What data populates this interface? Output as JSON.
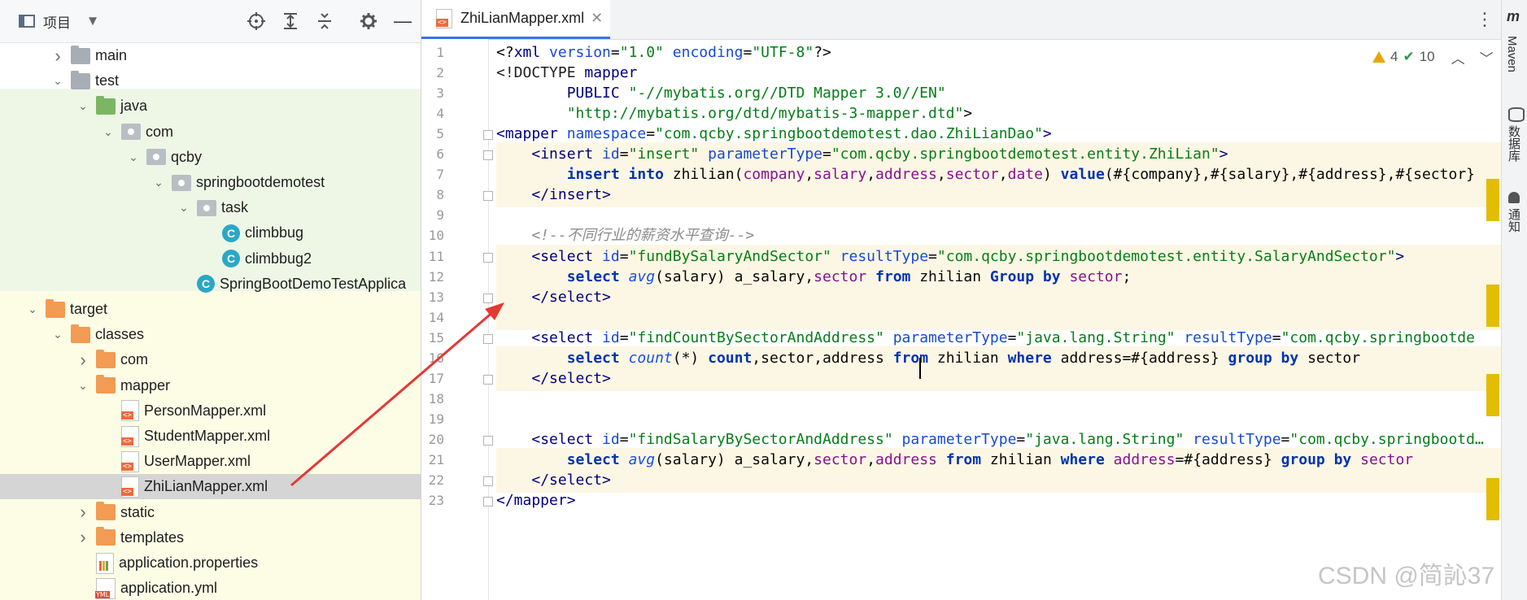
{
  "project_panel": {
    "title": "项目",
    "tree": [
      {
        "label": "main",
        "icon": "folder-grey-icon",
        "indent": 1,
        "chevron": "right"
      },
      {
        "label": "test",
        "icon": "folder-grey-icon",
        "indent": 1,
        "chevron": "down"
      },
      {
        "label": "java",
        "icon": "folder-green-icon",
        "indent": 2,
        "chevron": "down"
      },
      {
        "label": "com",
        "icon": "package-icon",
        "indent": 3,
        "chevron": "down"
      },
      {
        "label": "qcby",
        "icon": "package-icon",
        "indent": 4,
        "chevron": "down"
      },
      {
        "label": "springbootdemotest",
        "icon": "package-icon",
        "indent": 5,
        "chevron": "down"
      },
      {
        "label": "task",
        "icon": "package-icon",
        "indent": 6,
        "chevron": "down"
      },
      {
        "label": "climbbug",
        "icon": "class-icon",
        "indent": 7,
        "chevron": "none"
      },
      {
        "label": "climbbug2",
        "icon": "class-icon",
        "indent": 7,
        "chevron": "none"
      },
      {
        "label": "SpringBootDemoTestApplica",
        "icon": "class-icon",
        "indent": 6,
        "chevron": "none"
      },
      {
        "label": "target",
        "icon": "folder-orange-icon",
        "indent": 0,
        "chevron": "down"
      },
      {
        "label": "classes",
        "icon": "folder-orange-icon",
        "indent": 1,
        "chevron": "down"
      },
      {
        "label": "com",
        "icon": "folder-orange-icon",
        "indent": 2,
        "chevron": "right"
      },
      {
        "label": "mapper",
        "icon": "folder-orange-icon",
        "indent": 2,
        "chevron": "down"
      },
      {
        "label": "PersonMapper.xml",
        "icon": "xml-file-icon",
        "indent": 3,
        "chevron": "none"
      },
      {
        "label": "StudentMapper.xml",
        "icon": "xml-file-icon",
        "indent": 3,
        "chevron": "none"
      },
      {
        "label": "UserMapper.xml",
        "icon": "xml-file-icon",
        "indent": 3,
        "chevron": "none"
      },
      {
        "label": "ZhiLianMapper.xml",
        "icon": "xml-file-icon",
        "indent": 3,
        "chevron": "none",
        "selected": true
      },
      {
        "label": "static",
        "icon": "folder-orange-icon",
        "indent": 2,
        "chevron": "right"
      },
      {
        "label": "templates",
        "icon": "folder-orange-icon",
        "indent": 2,
        "chevron": "right"
      },
      {
        "label": "application.properties",
        "icon": "properties-file-icon",
        "indent": 2,
        "chevron": "none"
      },
      {
        "label": "application.yml",
        "icon": "yml-file-icon",
        "indent": 2,
        "chevron": "none"
      }
    ]
  },
  "editor": {
    "tab_label": "ZhiLianMapper.xml",
    "inspections": {
      "warnings": "4",
      "ok": "10"
    },
    "lines": [
      {
        "n": "1",
        "hl": false,
        "tokens": [
          [
            "plain",
            "<?"
          ],
          [
            "tag",
            "xml"
          ],
          [
            "attr",
            " version"
          ],
          [
            "plain",
            "="
          ],
          [
            "val",
            "\"1.0\""
          ],
          [
            "attr",
            " encoding"
          ],
          [
            "plain",
            "="
          ],
          [
            "val",
            "\"UTF-8\""
          ],
          [
            "plain",
            "?>"
          ]
        ]
      },
      {
        "n": "2",
        "hl": false,
        "tokens": [
          [
            "tagbg",
            "<!DOCTYPE "
          ],
          [
            "tag",
            "mapper"
          ]
        ]
      },
      {
        "n": "3",
        "hl": false,
        "tokens": [
          [
            "tag",
            "        PUBLIC "
          ],
          [
            "val",
            "\"-//mybatis.org//DTD Mapper 3.0//EN\""
          ]
        ]
      },
      {
        "n": "4",
        "hl": false,
        "tokens": [
          [
            "val",
            "        \"http://mybatis.org/dtd/mybatis-3-mapper.dtd\""
          ],
          [
            "plain",
            ">"
          ]
        ]
      },
      {
        "n": "5",
        "hl": false,
        "tokens": [
          [
            "tag",
            "<mapper"
          ],
          [
            "attr",
            " namespace"
          ],
          [
            "plain",
            "="
          ],
          [
            "val",
            "\"com.qcby.springbootdemotest.dao.ZhiLianDao\""
          ],
          [
            "tag",
            ">"
          ]
        ]
      },
      {
        "n": "6",
        "hl": true,
        "tokens": [
          [
            "plain",
            "    "
          ],
          [
            "tag",
            "<insert"
          ],
          [
            "attr",
            " id"
          ],
          [
            "plain",
            "="
          ],
          [
            "val",
            "\"insert\""
          ],
          [
            "attr",
            " parameterType"
          ],
          [
            "plain",
            "="
          ],
          [
            "val",
            "\"com.qcby.springbootdemotest.entity.ZhiLian\""
          ],
          [
            "tag",
            ">"
          ]
        ]
      },
      {
        "n": "7",
        "hl": true,
        "tokens": [
          [
            "plain",
            "        "
          ],
          [
            "kw",
            "insert into "
          ],
          [
            "plain",
            "zhilian("
          ],
          [
            "col",
            "company"
          ],
          [
            "plain",
            ","
          ],
          [
            "col",
            "salary"
          ],
          [
            "plain",
            ","
          ],
          [
            "col",
            "address"
          ],
          [
            "plain",
            ","
          ],
          [
            "col",
            "sector"
          ],
          [
            "plain",
            ","
          ],
          [
            "col",
            "date"
          ],
          [
            "plain",
            ") "
          ],
          [
            "kw",
            "value"
          ],
          [
            "plain",
            "(#{company},#{salary},#{address},#{sector}"
          ]
        ]
      },
      {
        "n": "8",
        "hl": true,
        "tokens": [
          [
            "plain",
            "    "
          ],
          [
            "tag",
            "</insert>"
          ]
        ]
      },
      {
        "n": "9",
        "hl": false,
        "tokens": []
      },
      {
        "n": "10",
        "hl": false,
        "tokens": [
          [
            "cm",
            "    <!--不同行业的薪资水平查询-->"
          ]
        ]
      },
      {
        "n": "11",
        "hl": true,
        "tokens": [
          [
            "plain",
            "    "
          ],
          [
            "tag",
            "<select"
          ],
          [
            "attr",
            " id"
          ],
          [
            "plain",
            "="
          ],
          [
            "val",
            "\"fundBySalaryAndSector\""
          ],
          [
            "attr",
            " resultType"
          ],
          [
            "plain",
            "="
          ],
          [
            "val",
            "\"com.qcby.springbootdemotest.entity.SalaryAndSector\""
          ],
          [
            "tag",
            ">"
          ]
        ]
      },
      {
        "n": "12",
        "hl": true,
        "tokens": [
          [
            "plain",
            "        "
          ],
          [
            "kw",
            "select "
          ],
          [
            "fn",
            "avg"
          ],
          [
            "plain",
            "(salary) a_salary,"
          ],
          [
            "col",
            "sector "
          ],
          [
            "kw",
            "from "
          ],
          [
            "plain",
            "zhilian "
          ],
          [
            "kw",
            "Group by "
          ],
          [
            "col",
            "sector"
          ],
          [
            "plain",
            ";"
          ]
        ]
      },
      {
        "n": "13",
        "hl": true,
        "tokens": [
          [
            "plain",
            "    "
          ],
          [
            "tag",
            "</select>"
          ]
        ]
      },
      {
        "n": "14",
        "hl": true,
        "tokens": []
      },
      {
        "n": "15",
        "hl": false,
        "tokens": [
          [
            "plain",
            "    "
          ],
          [
            "tag",
            "<select"
          ],
          [
            "attr",
            " id"
          ],
          [
            "plain",
            "="
          ],
          [
            "val",
            "\"findCountBySectorAndAddress\""
          ],
          [
            "attr",
            " parameterType"
          ],
          [
            "plain",
            "="
          ],
          [
            "val",
            "\"java.lang.String\""
          ],
          [
            "attr",
            " resultType"
          ],
          [
            "plain",
            "="
          ],
          [
            "val",
            "\"com.qcby.springbootde"
          ]
        ]
      },
      {
        "n": "16",
        "hl": true,
        "tokens": [
          [
            "plain",
            "        "
          ],
          [
            "kw",
            "select "
          ],
          [
            "fn",
            "count"
          ],
          [
            "plain",
            "(*) "
          ],
          [
            "kw",
            "count"
          ],
          [
            "plain",
            ",sector,address "
          ],
          [
            "kw",
            "from "
          ],
          [
            "plain",
            "zhilian "
          ],
          [
            "kw",
            "where "
          ],
          [
            "plain",
            "address=#{address} "
          ],
          [
            "kw",
            "group by "
          ],
          [
            "plain",
            "sector"
          ]
        ]
      },
      {
        "n": "17",
        "hl": true,
        "tokens": [
          [
            "plain",
            "    "
          ],
          [
            "tag",
            "</select>"
          ]
        ]
      },
      {
        "n": "18",
        "hl": false,
        "tokens": []
      },
      {
        "n": "19",
        "hl": false,
        "tokens": []
      },
      {
        "n": "20",
        "hl": false,
        "tokens": [
          [
            "plain",
            "    "
          ],
          [
            "tag",
            "<select"
          ],
          [
            "attr",
            " id"
          ],
          [
            "plain",
            "="
          ],
          [
            "val",
            "\"findSalaryBySectorAndAddress\""
          ],
          [
            "attr",
            " parameterType"
          ],
          [
            "plain",
            "="
          ],
          [
            "val",
            "\"java.lang.String\""
          ],
          [
            "attr",
            " resultType"
          ],
          [
            "plain",
            "="
          ],
          [
            "val",
            "\"com.qcby.springbootd…"
          ]
        ]
      },
      {
        "n": "21",
        "hl": true,
        "tokens": [
          [
            "plain",
            "        "
          ],
          [
            "kw",
            "select "
          ],
          [
            "fn",
            "avg"
          ],
          [
            "plain",
            "(salary) a_salary,"
          ],
          [
            "col",
            "sector"
          ],
          [
            "plain",
            ","
          ],
          [
            "col",
            "address "
          ],
          [
            "kw",
            "from "
          ],
          [
            "plain",
            "zhilian "
          ],
          [
            "kw",
            "where "
          ],
          [
            "col",
            "address"
          ],
          [
            "plain",
            "=#{address} "
          ],
          [
            "kw",
            "group by "
          ],
          [
            "col",
            "sector"
          ]
        ]
      },
      {
        "n": "22",
        "hl": true,
        "tokens": [
          [
            "plain",
            "    "
          ],
          [
            "tag",
            "</select>"
          ]
        ]
      },
      {
        "n": "23",
        "hl": false,
        "tokens": [
          [
            "tag",
            "</mapper>"
          ]
        ]
      }
    ]
  },
  "right_strip": {
    "maven": "Maven",
    "database": "数据库",
    "notifications": "通知"
  },
  "watermark": "CSDN @简訫37",
  "colors": {
    "accent": "#3574f0",
    "highlight": "#fcf7e4",
    "arrow": "#e53935",
    "warning": "#e6a700"
  }
}
